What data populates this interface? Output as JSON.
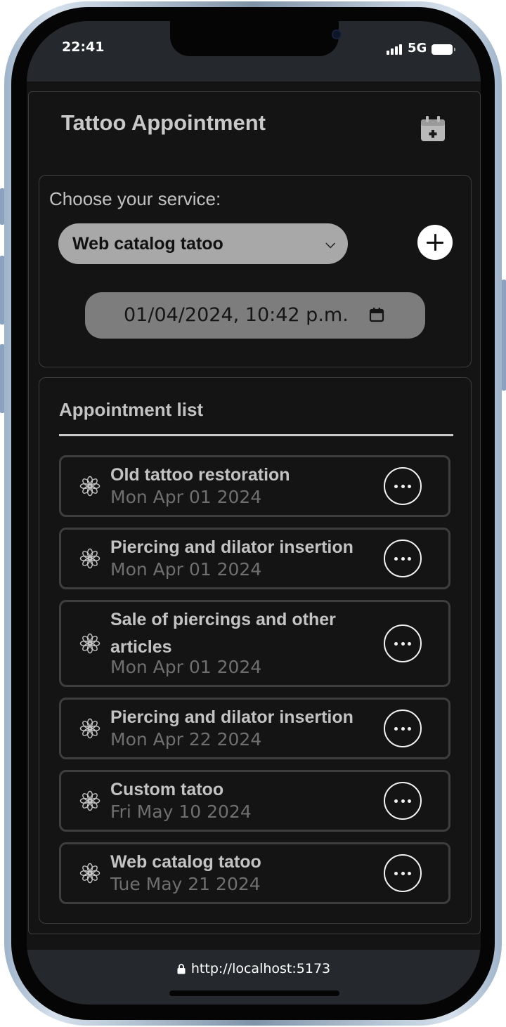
{
  "status_bar": {
    "time": "22:41",
    "network": "5G"
  },
  "app": {
    "title": "Tattoo Appointment",
    "calendar_icon": "calendar-plus-icon"
  },
  "service_form": {
    "label": "Choose your service:",
    "selected_service": "Web catalog tatoo",
    "datetime_value": "01/04/2024, 10:42 p.m.",
    "add_icon": "plus-circle-icon"
  },
  "appointments": {
    "title": "Appointment list",
    "items": [
      {
        "name": "Old tattoo restoration",
        "date": "Mon Apr 01 2024"
      },
      {
        "name": "Piercing and dilator insertion",
        "date": "Mon Apr 01 2024"
      },
      {
        "name": "Sale of piercings and other articles",
        "date": "Mon Apr 01 2024"
      },
      {
        "name": "Piercing and dilator insertion",
        "date": "Mon Apr 22 2024"
      },
      {
        "name": "Custom tatoo",
        "date": "Fri May 10 2024"
      },
      {
        "name": "Web catalog tatoo",
        "date": "Tue May 21 2024"
      }
    ],
    "item_icon": "flower-icon",
    "more_icon": "more-horizontal-icon"
  },
  "browser": {
    "url": "http://localhost:5173"
  },
  "colors": {
    "background": "#141414",
    "panel_border": "#3d3d3d",
    "text": "#c3c3c3",
    "muted": "#6f6f6f",
    "select_bg": "#a8a8a8",
    "datetime_bg": "#7d7d7d"
  }
}
